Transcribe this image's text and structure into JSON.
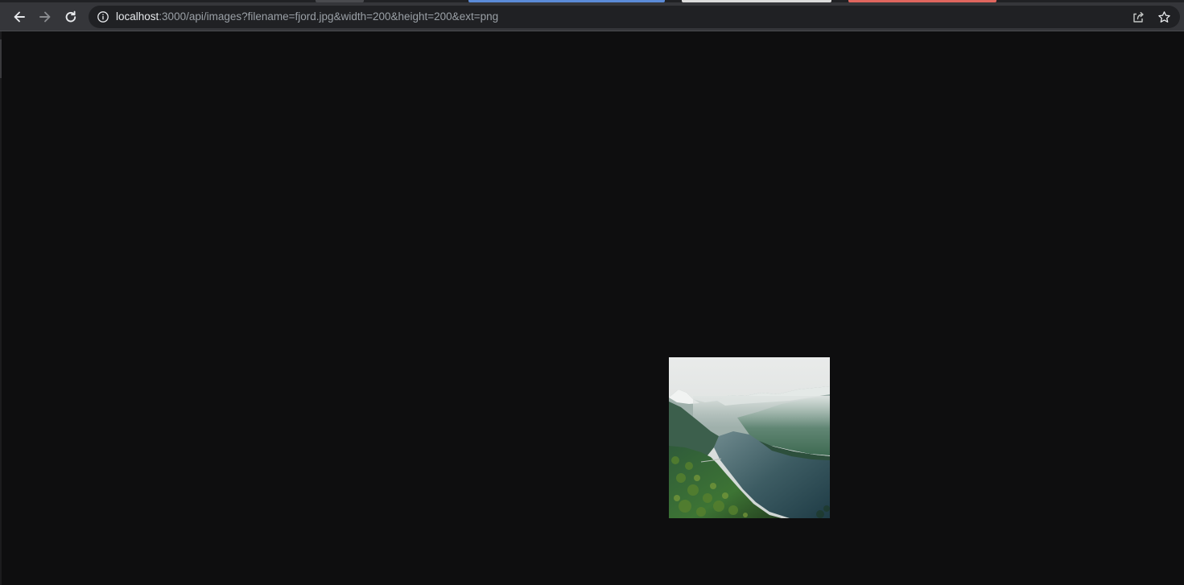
{
  "browser": {
    "url": {
      "host": "localhost",
      "rest": ":3000/api/images?filename=fjord.jpg&width=200&height=200&ext=png"
    },
    "icons": {
      "back": "arrow-left-icon",
      "forward": "arrow-right-icon",
      "reload": "reload-icon",
      "site_info": "info-icon",
      "share": "share-icon",
      "bookmark": "star-icon"
    },
    "colors": {
      "toolbar": "#35363a",
      "omnibox": "#202124",
      "page_background": "#0e0e0f",
      "tab_accent_blue": "#5b8bd8",
      "tab_accent_white": "#dcdcdc",
      "tab_accent_red": "#e0665e"
    }
  },
  "page": {
    "image": {
      "description_icon": "fjord-photo",
      "natural_width": 200,
      "natural_height": 200
    }
  }
}
